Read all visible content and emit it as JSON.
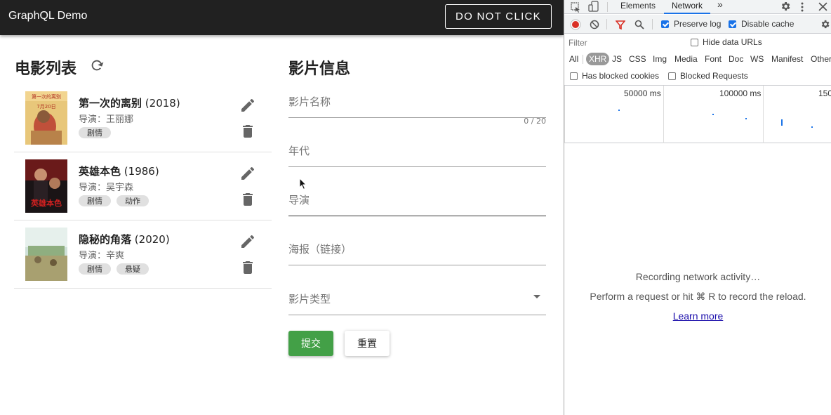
{
  "app": {
    "title": "GraphQL Demo",
    "do_not_click_label": "DO NOT CLICK"
  },
  "movie_list": {
    "title": "电影列表",
    "items": [
      {
        "name": "第一次的离别",
        "year": "(2018)",
        "director": "导演：王丽娜",
        "tags": [
          "剧情"
        ]
      },
      {
        "name": "英雄本色",
        "year": "(1986)",
        "director": "导演：吴宇森",
        "tags": [
          "剧情",
          "动作"
        ]
      },
      {
        "name": "隐秘的角落",
        "year": "(2020)",
        "director": "导演：辛爽",
        "tags": [
          "剧情",
          "悬疑"
        ]
      }
    ]
  },
  "form": {
    "title": "影片信息",
    "name_placeholder": "影片名称",
    "name_counter": "0 / 20",
    "year_placeholder": "年代",
    "director_placeholder": "导演",
    "poster_placeholder": "海报（链接）",
    "genre_placeholder": "影片类型",
    "submit_label": "提交",
    "reset_label": "重置"
  },
  "devtools": {
    "tabs": [
      "Elements",
      "Network",
      "»"
    ],
    "active_tab": "Network",
    "preserve_log_label": "Preserve log",
    "disable_cache_label": "Disable cache",
    "filter_placeholder": "Filter",
    "hide_data_urls_label": "Hide data URLs",
    "type_filters": [
      "All",
      "XHR",
      "JS",
      "CSS",
      "Img",
      "Media",
      "Font",
      "Doc",
      "WS",
      "Manifest",
      "Other"
    ],
    "active_type": "XHR",
    "blocked_cookies_label": "Has blocked cookies",
    "blocked_requests_label": "Blocked Requests",
    "timeline_labels": [
      "50000 ms",
      "100000 ms",
      "150"
    ],
    "recording_text": "Recording network activity…",
    "perform_text": "Perform a request or hit ⌘ R to record the reload.",
    "learn_more": "Learn more",
    "colors": {
      "record": "#d93025",
      "accent": "#1a73e8"
    }
  }
}
